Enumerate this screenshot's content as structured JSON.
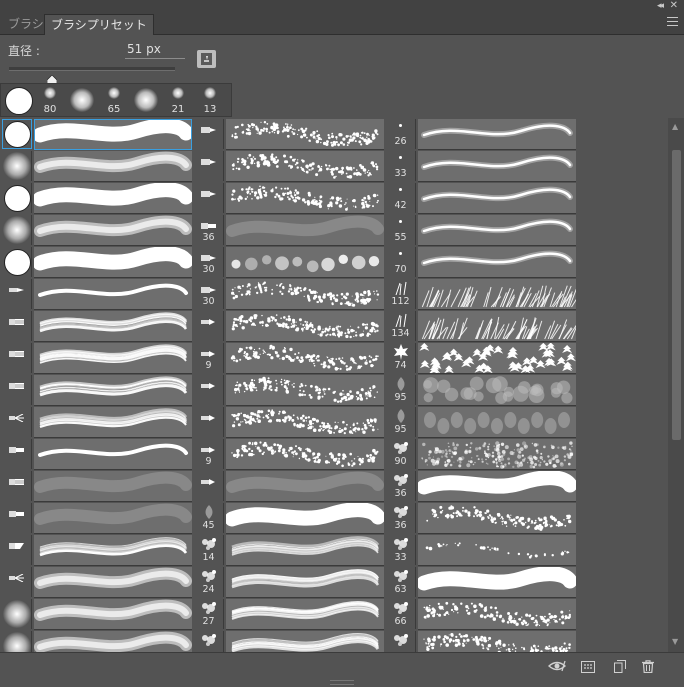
{
  "tabs": [
    {
      "label": "ブラシ",
      "active": false
    },
    {
      "label": "ブラシプリセット",
      "active": true
    }
  ],
  "diameter": {
    "label": "直径 :",
    "value": "51 px",
    "slider_fraction": 0.26
  },
  "recent_brushes": [
    {
      "size": "",
      "kind": "hard"
    },
    {
      "size": "80",
      "kind": "soft"
    },
    {
      "size": "",
      "kind": "soft"
    },
    {
      "size": "65",
      "kind": "soft"
    },
    {
      "size": "",
      "kind": "soft"
    },
    {
      "size": "21",
      "kind": "soft"
    },
    {
      "size": "13",
      "kind": "soft"
    }
  ],
  "columns": [
    {
      "presets": [
        {
          "icon": "hard-round",
          "count": "",
          "stroke": "hard",
          "selected": true
        },
        {
          "icon": "soft-round",
          "count": "",
          "stroke": "soft"
        },
        {
          "icon": "hard-round",
          "count": "",
          "stroke": "hard"
        },
        {
          "icon": "soft-round",
          "count": "",
          "stroke": "soft"
        },
        {
          "icon": "hard-round",
          "count": "",
          "stroke": "hard"
        },
        {
          "icon": "pencil-tip",
          "count": "",
          "stroke": "thin"
        },
        {
          "icon": "bristle-tip",
          "count": "",
          "stroke": "bristle"
        },
        {
          "icon": "bristle-tip",
          "count": "",
          "stroke": "bristle"
        },
        {
          "icon": "bristle-tip",
          "count": "",
          "stroke": "bristle"
        },
        {
          "icon": "fan-tip",
          "count": "",
          "stroke": "bristle"
        },
        {
          "icon": "flat-tip",
          "count": "",
          "stroke": "thin"
        },
        {
          "icon": "bristle-tip",
          "count": "",
          "stroke": "faint"
        },
        {
          "icon": "flat-tip",
          "count": "",
          "stroke": "faint"
        },
        {
          "icon": "angle-tip",
          "count": "",
          "stroke": "bristle"
        },
        {
          "icon": "fan-tip",
          "count": "",
          "stroke": "soft"
        },
        {
          "icon": "soft-round",
          "count": "",
          "stroke": "soft"
        },
        {
          "icon": "soft-round",
          "count": "",
          "stroke": "soft"
        }
      ]
    },
    {
      "presets": [
        {
          "icon": "airbrush",
          "count": "",
          "stroke": "spatter"
        },
        {
          "icon": "airbrush",
          "count": "",
          "stroke": "spatter"
        },
        {
          "icon": "airbrush",
          "count": "",
          "stroke": "spatter"
        },
        {
          "icon": "flat-tip",
          "count": "36",
          "stroke": "faint"
        },
        {
          "icon": "airbrush",
          "count": "30",
          "stroke": "dots"
        },
        {
          "icon": "airbrush",
          "count": "30",
          "stroke": "spatter"
        },
        {
          "icon": "pen-tip",
          "count": "",
          "stroke": "spatter"
        },
        {
          "icon": "pen-tip",
          "count": "9",
          "stroke": "spatter"
        },
        {
          "icon": "pen-tip",
          "count": "",
          "stroke": "spatter"
        },
        {
          "icon": "pen-tip",
          "count": "",
          "stroke": "spatter"
        },
        {
          "icon": "pen-tip",
          "count": "9",
          "stroke": "spatter"
        },
        {
          "icon": "pen-tip",
          "count": "",
          "stroke": "faint"
        },
        {
          "icon": "leaf",
          "count": "45",
          "stroke": "hard"
        },
        {
          "icon": "spray",
          "count": "14",
          "stroke": "bristle"
        },
        {
          "icon": "spray",
          "count": "24",
          "stroke": "bristle"
        },
        {
          "icon": "spray",
          "count": "27",
          "stroke": "bristle"
        },
        {
          "icon": "spray",
          "count": "",
          "stroke": "bristle"
        }
      ]
    },
    {
      "presets": [
        {
          "icon": "dot",
          "count": "26",
          "stroke": "glow"
        },
        {
          "icon": "dot",
          "count": "33",
          "stroke": "glow"
        },
        {
          "icon": "dot",
          "count": "42",
          "stroke": "glow"
        },
        {
          "icon": "dot",
          "count": "55",
          "stroke": "glow"
        },
        {
          "icon": "dot",
          "count": "70",
          "stroke": "glow"
        },
        {
          "icon": "grass",
          "count": "112",
          "stroke": "grass"
        },
        {
          "icon": "grass",
          "count": "134",
          "stroke": "grass"
        },
        {
          "icon": "maple-leaf",
          "count": "74",
          "stroke": "leaves"
        },
        {
          "icon": "leaf",
          "count": "95",
          "stroke": "blobs"
        },
        {
          "icon": "leaf",
          "count": "95",
          "stroke": "petals"
        },
        {
          "icon": "texture",
          "count": "90",
          "stroke": "texture"
        },
        {
          "icon": "texture",
          "count": "36",
          "stroke": "hard"
        },
        {
          "icon": "texture",
          "count": "36",
          "stroke": "spatter"
        },
        {
          "icon": "texture",
          "count": "33",
          "stroke": "dots-line"
        },
        {
          "icon": "texture",
          "count": "63",
          "stroke": "hard"
        },
        {
          "icon": "texture",
          "count": "66",
          "stroke": "spatter"
        },
        {
          "icon": "texture",
          "count": "",
          "stroke": "spatter"
        }
      ]
    }
  ],
  "bottom_icons": [
    "eye-icon",
    "panel-grid-icon",
    "new-brush-icon",
    "trash-icon"
  ]
}
